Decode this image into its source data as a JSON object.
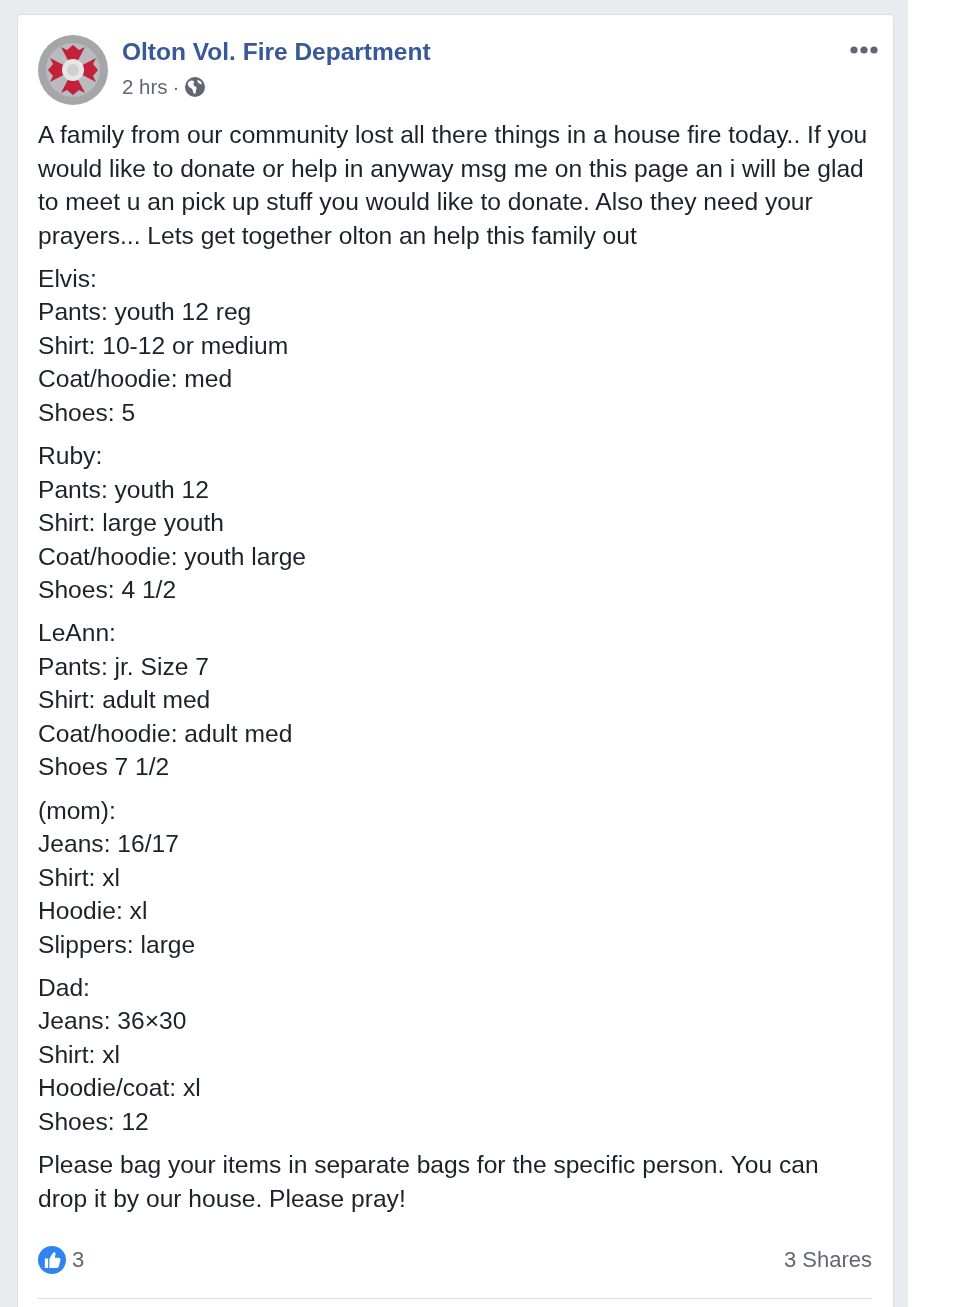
{
  "post": {
    "author": "Olton Vol. Fire Department",
    "time": "2 hrs",
    "separator": "·",
    "body": [
      {
        "kind": "paragraph",
        "text": "A family from our community lost all there things in a house fire today.. If you would like to donate or help in anyway msg me on this page an i will be glad to meet u an pick up stuff you would like to donate. Also they need your prayers... Lets get together olton an help this family out"
      },
      {
        "kind": "list",
        "lines": [
          "Elvis:",
          "Pants: youth 12 reg",
          "Shirt: 10-12 or medium",
          "Coat/hoodie: med",
          "Shoes: 5"
        ]
      },
      {
        "kind": "list",
        "lines": [
          "Ruby:",
          "Pants: youth 12",
          "Shirt: large youth",
          "Coat/hoodie: youth large",
          "Shoes: 4 1/2"
        ]
      },
      {
        "kind": "list",
        "lines": [
          "LeAnn:",
          "Pants: jr. Size 7",
          "Shirt: adult med",
          "Coat/hoodie: adult med",
          "Shoes 7 1/2"
        ]
      },
      {
        "kind": "list",
        "lines": [
          "(mom):",
          "Jeans: 16/17",
          "Shirt: xl",
          "Hoodie: xl",
          "Slippers: large"
        ]
      },
      {
        "kind": "list",
        "lines": [
          "Dad:",
          "Jeans: 36×30",
          "Shirt: xl",
          "Hoodie/coat: xl",
          "Shoes: 12"
        ]
      },
      {
        "kind": "paragraph",
        "text": "Please bag your items in separate bags for the specific person. You can drop it by our house. Please pray!"
      }
    ],
    "likes": "3",
    "shares": "3 Shares"
  }
}
